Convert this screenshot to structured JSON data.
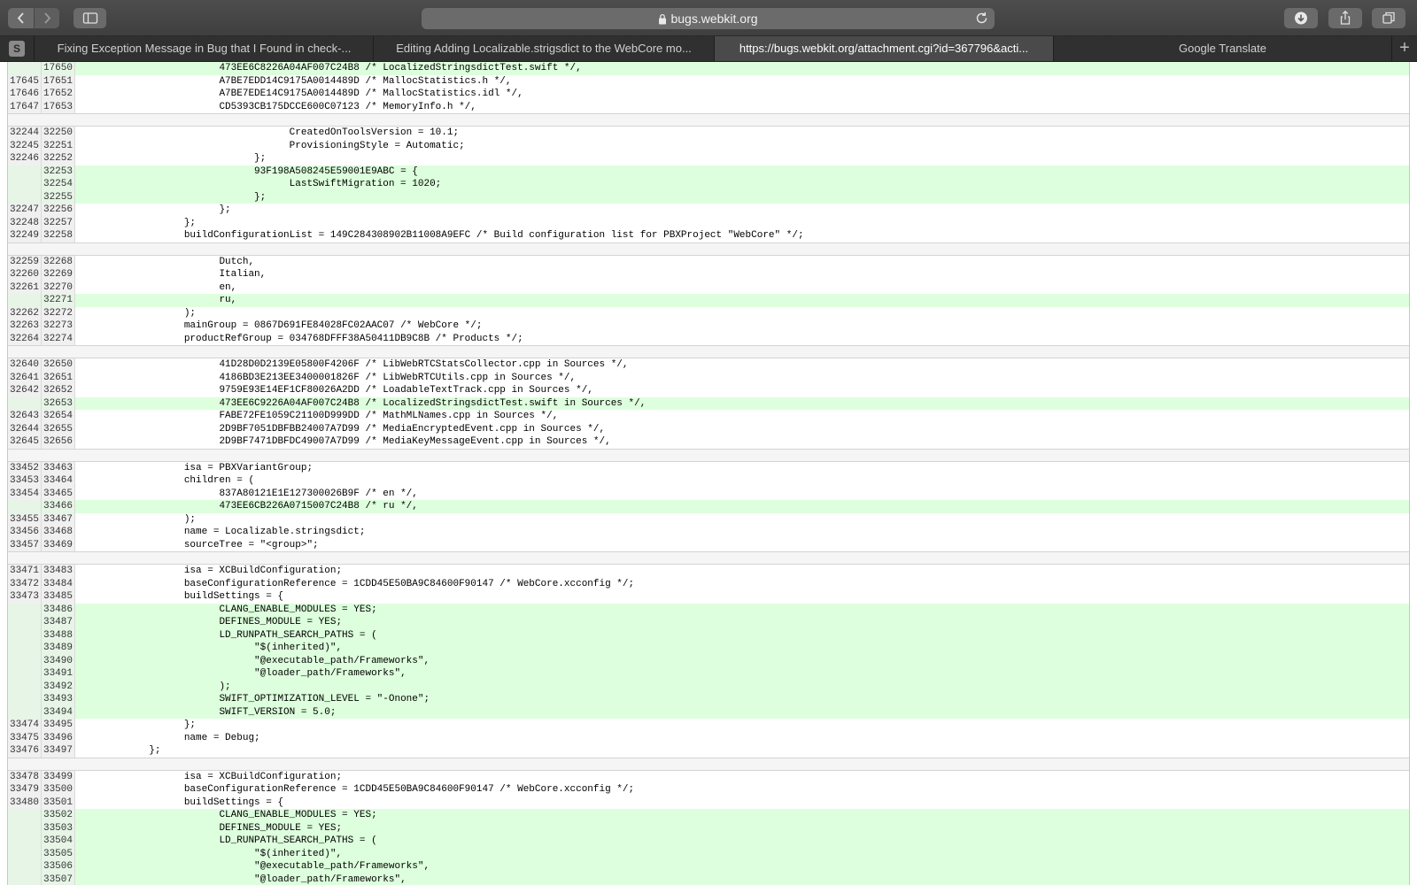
{
  "browser": {
    "address": "bugs.webkit.org",
    "pinned_tab_letter": "S",
    "tabs": [
      {
        "label": "Fixing Exception Message in Bug that I Found in check-..."
      },
      {
        "label": "Editing Adding Localizable.strigsdict to the WebCore mo..."
      },
      {
        "label": "https://bugs.webkit.org/attachment.cgi?id=367796&acti..."
      },
      {
        "label": "Google Translate"
      }
    ],
    "active_tab": 2,
    "new_tab_label": "+"
  },
  "diff": {
    "hunks": [
      {
        "lines": [
          {
            "old": "",
            "new": "17650",
            "text": "\t\t\t\t473EE6C8226A04AF007C24B8 /* LocalizedStringsdictTest.swift */,",
            "added": true
          },
          {
            "old": "17645",
            "new": "17651",
            "text": "\t\t\t\tA7BE7EDD14C9175A0014489D /* MallocStatistics.h */,",
            "added": false
          },
          {
            "old": "17646",
            "new": "17652",
            "text": "\t\t\t\tA7BE7EDE14C9175A0014489D /* MallocStatistics.idl */,",
            "added": false
          },
          {
            "old": "17647",
            "new": "17653",
            "text": "\t\t\t\tCD5393CB175DCCE600C07123 /* MemoryInfo.h */,",
            "added": false
          }
        ]
      },
      {
        "lines": [
          {
            "old": "32244",
            "new": "32250",
            "text": "\t\t\t\t\t\tCreatedOnToolsVersion = 10.1;",
            "added": false
          },
          {
            "old": "32245",
            "new": "32251",
            "text": "\t\t\t\t\t\tProvisioningStyle = Automatic;",
            "added": false
          },
          {
            "old": "32246",
            "new": "32252",
            "text": "\t\t\t\t\t};",
            "added": false
          },
          {
            "old": "",
            "new": "32253",
            "text": "\t\t\t\t\t93F198A508245E59001E9ABC = {",
            "added": true
          },
          {
            "old": "",
            "new": "32254",
            "text": "\t\t\t\t\t\tLastSwiftMigration = 1020;",
            "added": true
          },
          {
            "old": "",
            "new": "32255",
            "text": "\t\t\t\t\t};",
            "added": true
          },
          {
            "old": "32247",
            "new": "32256",
            "text": "\t\t\t\t};",
            "added": false
          },
          {
            "old": "32248",
            "new": "32257",
            "text": "\t\t\t};",
            "added": false
          },
          {
            "old": "32249",
            "new": "32258",
            "text": "\t\t\tbuildConfigurationList = 149C284308902B11008A9EFC /* Build configuration list for PBXProject \"WebCore\" */;",
            "added": false
          }
        ]
      },
      {
        "lines": [
          {
            "old": "32259",
            "new": "32268",
            "text": "\t\t\t\tDutch,",
            "added": false
          },
          {
            "old": "32260",
            "new": "32269",
            "text": "\t\t\t\tItalian,",
            "added": false
          },
          {
            "old": "32261",
            "new": "32270",
            "text": "\t\t\t\ten,",
            "added": false
          },
          {
            "old": "",
            "new": "32271",
            "text": "\t\t\t\tru,",
            "added": true
          },
          {
            "old": "32262",
            "new": "32272",
            "text": "\t\t\t);",
            "added": false
          },
          {
            "old": "32263",
            "new": "32273",
            "text": "\t\t\tmainGroup = 0867D691FE84028FC02AAC07 /* WebCore */;",
            "added": false
          },
          {
            "old": "32264",
            "new": "32274",
            "text": "\t\t\tproductRefGroup = 034768DFFF38A50411DB9C8B /* Products */;",
            "added": false
          }
        ]
      },
      {
        "lines": [
          {
            "old": "32640",
            "new": "32650",
            "text": "\t\t\t\t41D28D0D2139E05800F4206F /* LibWebRTCStatsCollector.cpp in Sources */,",
            "added": false
          },
          {
            "old": "32641",
            "new": "32651",
            "text": "\t\t\t\t4186BD3E213EE3400001826F /* LibWebRTCUtils.cpp in Sources */,",
            "added": false
          },
          {
            "old": "32642",
            "new": "32652",
            "text": "\t\t\t\t9759E93E14EF1CF80026A2DD /* LoadableTextTrack.cpp in Sources */,",
            "added": false
          },
          {
            "old": "",
            "new": "32653",
            "text": "\t\t\t\t473EE6C9226A04AF007C24B8 /* LocalizedStringsdictTest.swift in Sources */,",
            "added": true
          },
          {
            "old": "32643",
            "new": "32654",
            "text": "\t\t\t\tFABE72FE1059C21100D999DD /* MathMLNames.cpp in Sources */,",
            "added": false
          },
          {
            "old": "32644",
            "new": "32655",
            "text": "\t\t\t\t2D9BF7051DBFBB24007A7D99 /* MediaEncryptedEvent.cpp in Sources */,",
            "added": false
          },
          {
            "old": "32645",
            "new": "32656",
            "text": "\t\t\t\t2D9BF7471DBFDC49007A7D99 /* MediaKeyMessageEvent.cpp in Sources */,",
            "added": false
          }
        ]
      },
      {
        "lines": [
          {
            "old": "33452",
            "new": "33463",
            "text": "\t\t\tisa = PBXVariantGroup;",
            "added": false
          },
          {
            "old": "33453",
            "new": "33464",
            "text": "\t\t\tchildren = (",
            "added": false
          },
          {
            "old": "33454",
            "new": "33465",
            "text": "\t\t\t\t837A80121E1E127300026B9F /* en */,",
            "added": false
          },
          {
            "old": "",
            "new": "33466",
            "text": "\t\t\t\t473EE6CB226A0715007C24B8 /* ru */,",
            "added": true
          },
          {
            "old": "33455",
            "new": "33467",
            "text": "\t\t\t);",
            "added": false
          },
          {
            "old": "33456",
            "new": "33468",
            "text": "\t\t\tname = Localizable.stringsdict;",
            "added": false
          },
          {
            "old": "33457",
            "new": "33469",
            "text": "\t\t\tsourceTree = \"<group>\";",
            "added": false
          }
        ]
      },
      {
        "lines": [
          {
            "old": "33471",
            "new": "33483",
            "text": "\t\t\tisa = XCBuildConfiguration;",
            "added": false
          },
          {
            "old": "33472",
            "new": "33484",
            "text": "\t\t\tbaseConfigurationReference = 1CDD45E50BA9C84600F90147 /* WebCore.xcconfig */;",
            "added": false
          },
          {
            "old": "33473",
            "new": "33485",
            "text": "\t\t\tbuildSettings = {",
            "added": false
          },
          {
            "old": "",
            "new": "33486",
            "text": "\t\t\t\tCLANG_ENABLE_MODULES = YES;",
            "added": true
          },
          {
            "old": "",
            "new": "33487",
            "text": "\t\t\t\tDEFINES_MODULE = YES;",
            "added": true
          },
          {
            "old": "",
            "new": "33488",
            "text": "\t\t\t\tLD_RUNPATH_SEARCH_PATHS = (",
            "added": true
          },
          {
            "old": "",
            "new": "33489",
            "text": "\t\t\t\t\t\"$(inherited)\",",
            "added": true
          },
          {
            "old": "",
            "new": "33490",
            "text": "\t\t\t\t\t\"@executable_path/Frameworks\",",
            "added": true
          },
          {
            "old": "",
            "new": "33491",
            "text": "\t\t\t\t\t\"@loader_path/Frameworks\",",
            "added": true
          },
          {
            "old": "",
            "new": "33492",
            "text": "\t\t\t\t);",
            "added": true
          },
          {
            "old": "",
            "new": "33493",
            "text": "\t\t\t\tSWIFT_OPTIMIZATION_LEVEL = \"-Onone\";",
            "added": true
          },
          {
            "old": "",
            "new": "33494",
            "text": "\t\t\t\tSWIFT_VERSION = 5.0;",
            "added": true
          },
          {
            "old": "33474",
            "new": "33495",
            "text": "\t\t\t};",
            "added": false
          },
          {
            "old": "33475",
            "new": "33496",
            "text": "\t\t\tname = Debug;",
            "added": false
          },
          {
            "old": "33476",
            "new": "33497",
            "text": "\t\t};",
            "added": false
          }
        ]
      },
      {
        "lines": [
          {
            "old": "33478",
            "new": "33499",
            "text": "\t\t\tisa = XCBuildConfiguration;",
            "added": false
          },
          {
            "old": "33479",
            "new": "33500",
            "text": "\t\t\tbaseConfigurationReference = 1CDD45E50BA9C84600F90147 /* WebCore.xcconfig */;",
            "added": false
          },
          {
            "old": "33480",
            "new": "33501",
            "text": "\t\t\tbuildSettings = {",
            "added": false
          },
          {
            "old": "",
            "new": "33502",
            "text": "\t\t\t\tCLANG_ENABLE_MODULES = YES;",
            "added": true
          },
          {
            "old": "",
            "new": "33503",
            "text": "\t\t\t\tDEFINES_MODULE = YES;",
            "added": true
          },
          {
            "old": "",
            "new": "33504",
            "text": "\t\t\t\tLD_RUNPATH_SEARCH_PATHS = (",
            "added": true
          },
          {
            "old": "",
            "new": "33505",
            "text": "\t\t\t\t\t\"$(inherited)\",",
            "added": true
          },
          {
            "old": "",
            "new": "33506",
            "text": "\t\t\t\t\t\"@executable_path/Frameworks\",",
            "added": true
          },
          {
            "old": "",
            "new": "33507",
            "text": "\t\t\t\t\t\"@loader_path/Frameworks\",",
            "added": true
          }
        ]
      }
    ]
  },
  "colors": {
    "added_line_bg": "#ddffdd",
    "gutter_bg": "#f0f0f0",
    "toolbar_bg": "#454545",
    "active_tab_bg": "#4a4a4a"
  },
  "icons": {
    "back": "chevron-left-icon",
    "forward": "chevron-right-icon",
    "sidebar": "sidebar-icon",
    "lock": "lock-icon",
    "reload": "reload-icon",
    "download": "download-icon",
    "share": "share-icon",
    "tabs": "tab-overview-icon"
  }
}
